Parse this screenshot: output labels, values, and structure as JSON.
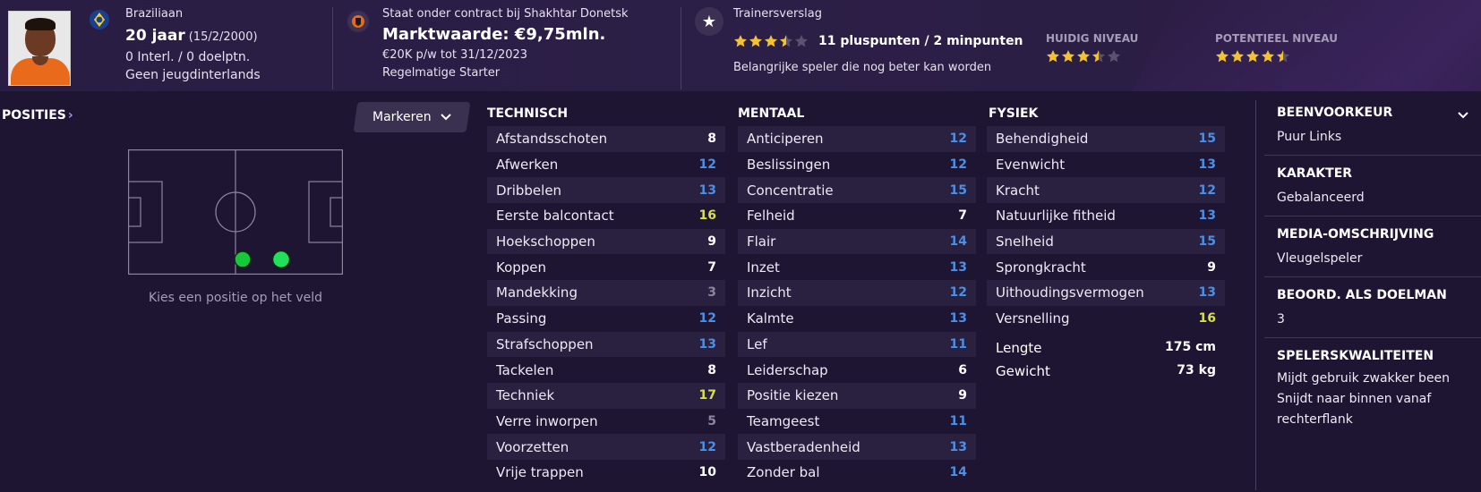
{
  "header": {
    "nationality": "Braziliaan",
    "age": "20 jaar",
    "dob": "(15/2/2000)",
    "caps": "0 Interl. / 0 doelptn.",
    "youth": "Geen jeugdinterlands",
    "contract": "Staat onder contract bij Shakhtar Donetsk",
    "value": "Marktwaarde: €9,75mln.",
    "wage": "€20K p/w tot 31/12/2023",
    "role": "Regelmatige Starter",
    "report_title": "Trainersverslag",
    "report_rating": 3.5,
    "report_points": "11 pluspunten / 2 minpunten",
    "report_desc": "Belangrijke speler die nog beter kan worden",
    "current_label": "HUIDIG NIVEAU",
    "current_rating": 3.5,
    "potential_label": "POTENTIEEL NIVEAU",
    "potential_rating": 4.5,
    "star_color": "#f2c230",
    "star_empty_color": "#5b5270"
  },
  "positions": {
    "title": "POSITIES",
    "button": "Markeren",
    "hint": "Kies een positie op het veld"
  },
  "colors": {
    "white": "#ffffff",
    "blue": "#4b8fe6",
    "grey": "#8d849e",
    "yellow": "#d7e049",
    "position_dot": "#16c93c"
  },
  "technical": {
    "title": "TECHNISCH",
    "rows": [
      {
        "name": "Afstandsschoten",
        "value": "8",
        "tone": "white"
      },
      {
        "name": "Afwerken",
        "value": "12",
        "tone": "blue"
      },
      {
        "name": "Dribbelen",
        "value": "13",
        "tone": "blue"
      },
      {
        "name": "Eerste balcontact",
        "value": "16",
        "tone": "yellow"
      },
      {
        "name": "Hoekschoppen",
        "value": "9",
        "tone": "white"
      },
      {
        "name": "Koppen",
        "value": "7",
        "tone": "white"
      },
      {
        "name": "Mandekking",
        "value": "3",
        "tone": "grey"
      },
      {
        "name": "Passing",
        "value": "12",
        "tone": "blue"
      },
      {
        "name": "Strafschoppen",
        "value": "13",
        "tone": "blue"
      },
      {
        "name": "Tackelen",
        "value": "8",
        "tone": "white"
      },
      {
        "name": "Techniek",
        "value": "17",
        "tone": "yellow"
      },
      {
        "name": "Verre inworpen",
        "value": "5",
        "tone": "grey"
      },
      {
        "name": "Voorzetten",
        "value": "12",
        "tone": "blue"
      },
      {
        "name": "Vrije trappen",
        "value": "10",
        "tone": "white"
      }
    ]
  },
  "mental": {
    "title": "MENTAAL",
    "rows": [
      {
        "name": "Anticiperen",
        "value": "12",
        "tone": "blue"
      },
      {
        "name": "Beslissingen",
        "value": "12",
        "tone": "blue"
      },
      {
        "name": "Concentratie",
        "value": "15",
        "tone": "blue"
      },
      {
        "name": "Felheid",
        "value": "7",
        "tone": "white"
      },
      {
        "name": "Flair",
        "value": "14",
        "tone": "blue"
      },
      {
        "name": "Inzet",
        "value": "13",
        "tone": "blue"
      },
      {
        "name": "Inzicht",
        "value": "12",
        "tone": "blue"
      },
      {
        "name": "Kalmte",
        "value": "13",
        "tone": "blue"
      },
      {
        "name": "Lef",
        "value": "11",
        "tone": "blue"
      },
      {
        "name": "Leiderschap",
        "value": "6",
        "tone": "white"
      },
      {
        "name": "Positie kiezen",
        "value": "9",
        "tone": "white"
      },
      {
        "name": "Teamgeest",
        "value": "11",
        "tone": "blue"
      },
      {
        "name": "Vastberadenheid",
        "value": "13",
        "tone": "blue"
      },
      {
        "name": "Zonder bal",
        "value": "14",
        "tone": "blue"
      }
    ]
  },
  "physical": {
    "title": "FYSIEK",
    "rows": [
      {
        "name": "Behendigheid",
        "value": "15",
        "tone": "blue"
      },
      {
        "name": "Evenwicht",
        "value": "13",
        "tone": "blue"
      },
      {
        "name": "Kracht",
        "value": "12",
        "tone": "blue"
      },
      {
        "name": "Natuurlijke fitheid",
        "value": "13",
        "tone": "blue"
      },
      {
        "name": "Snelheid",
        "value": "15",
        "tone": "blue"
      },
      {
        "name": "Sprongkracht",
        "value": "9",
        "tone": "white"
      },
      {
        "name": "Uithoudingsvermogen",
        "value": "13",
        "tone": "blue"
      },
      {
        "name": "Versnelling",
        "value": "16",
        "tone": "yellow"
      }
    ],
    "height_label": "Lengte",
    "height_value": "175 cm",
    "weight_label": "Gewicht",
    "weight_value": "73 kg"
  },
  "info": {
    "foot_title": "BEENVOORKEUR",
    "foot_value": "Puur Links",
    "character_title": "KARAKTER",
    "character_value": "Gebalanceerd",
    "media_title": "MEDIA-OMSCHRIJVING",
    "media_value": "Vleugelspeler",
    "gk_title": "BEOORD. ALS DOELMAN",
    "gk_value": "3",
    "traits_title": "SPELERSKWALITEITEN",
    "traits": [
      "Mijdt gebruik zwakker been",
      "Snijdt naar binnen vanaf rechterflank"
    ]
  }
}
